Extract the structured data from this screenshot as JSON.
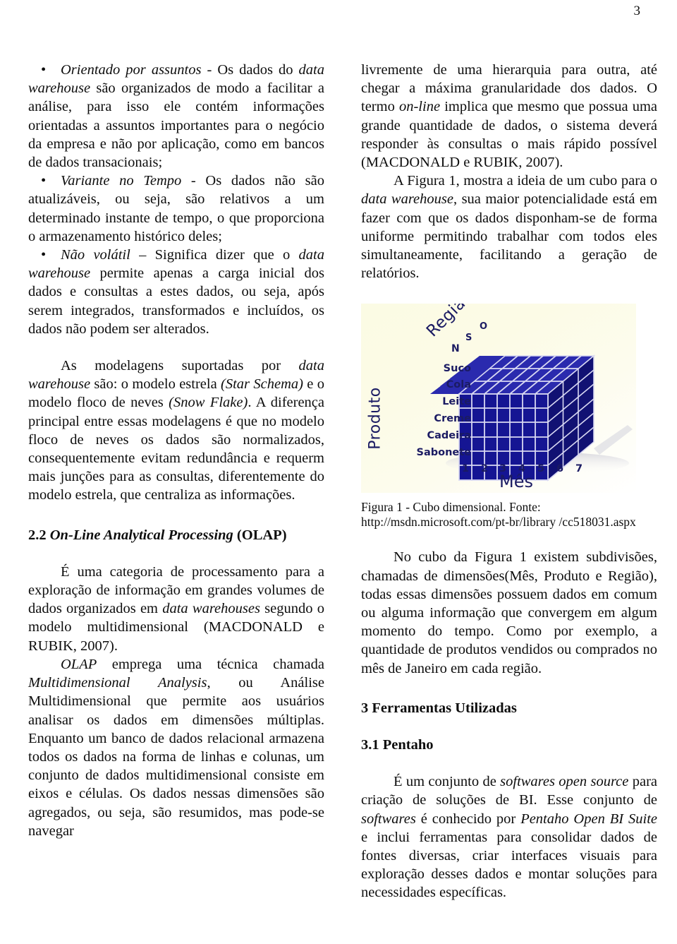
{
  "page": {
    "number": "3"
  },
  "left_column": {
    "bullet_1": {
      "term": "Orientado por assuntos",
      "text": " - Os dados do ",
      "term2": "data warehouse",
      "rest": " são organizados de modo a facilitar a análise, para isso ele contém informações orientadas a assuntos importantes para o negócio da empresa e não por aplicação, como em bancos de dados transacionais;"
    },
    "bullet_2": {
      "term": "Variante no Tempo",
      "rest": " - Os dados não são atualizáveis, ou seja, são relativos a um determinado instante de tempo, o que proporciona o armazenamento histórico deles;"
    },
    "bullet_3": {
      "term": "Não volátil",
      "mid": " – Significa dizer que o ",
      "term2": "data warehouse",
      "rest": " permite apenas a carga inicial dos dados e consultas a estes dados, ou seja, após serem integrados, transformados e incluídos, os dados não podem ser alterados."
    },
    "paragraph_modelagens": {
      "p1": "As modelagens suportadas por ",
      "i1": "data warehouse",
      "p2": " são: o modelo estrela ",
      "i2": "(Star Schema)",
      "p3": " e o modelo floco de neves ",
      "i3": "(Snow Flake)",
      "p4": ". A diferença principal entre essas modelagens é que no modelo floco de neves os dados são normalizados, consequentemente evitam redundância e requerm mais junções para as consultas, diferentemente do modelo estrela, que centraliza as informações."
    },
    "heading_olap": {
      "number": "2.2 ",
      "title_italic": "On-Line Analytical Processing",
      "title_rest": " (OLAP)"
    },
    "paragraph_olap_1": {
      "p1": "É uma categoria de processamento para a exploração de informação em grandes volumes de dados organizados em ",
      "i1": "data warehouses",
      "p2": " segundo o modelo multidimensional (MACDONALD e RUBIK, 2007)."
    },
    "paragraph_olap_2": {
      "i1": "OLAP",
      "p1": " emprega uma técnica chamada ",
      "i2": "Multidimensional Analysis",
      "p2": ", ou Análise Multidimensional que permite aos usuários analisar os dados em dimensões múltiplas. Enquanto um banco de dados relacional armazena todos os dados na forma de linhas e colunas, um conjunto de dados multidimensional consiste em eixos e células. Os dados nessas dimensões são agregados, ou seja, são resumidos, mas pode-se navegar"
    }
  },
  "right_column": {
    "paragraph_cont": {
      "p1": "livremente de uma hierarquia para outra, até chegar a máxima granularidade dos dados. O termo ",
      "i1": "on-line",
      "p2": " implica que mesmo que possua uma grande quantidade de dados, o sistema deverá responder às consultas o mais rápido possível (MACDONALD e RUBIK, 2007)."
    },
    "paragraph_figura": {
      "p1": "A Figura 1, mostra a ideia de um cubo para o ",
      "i1": "data warehouse",
      "p2": ", sua maior potencialidade está em fazer com que os dados disponham-se de forma uniforme permitindo trabalhar com todos eles simultaneamente, facilitando a geração de relatórios."
    },
    "figure": {
      "caption_line1": "Figura 1 - Cubo dimensional.  Fonte:",
      "caption_line2": "http://msdn.microsoft.com/pt-br/library /cc518031.aspx",
      "axis_product_label": "Produto",
      "axis_region_label": "Região",
      "axis_month_label": "Mês",
      "products": [
        "Suco",
        "Cola",
        "Leite",
        "Creme",
        "Cadeira",
        "Sabonete"
      ],
      "months": [
        "1",
        "2",
        "3",
        "4",
        "5",
        "6",
        "7"
      ],
      "regions": [
        "N",
        "S",
        "O"
      ],
      "colors": {
        "cube_front": "#151593",
        "cube_top": "#2b2bb0",
        "cube_side": "#0f0f66",
        "grid_line": "#ccccee",
        "label_text": "#1b1b63",
        "background": "#fbfbe4"
      }
    },
    "paragraph_cubo": "No cubo da Figura 1 existem subdivisões, chamadas de dimensões(Mês, Produto e Região), todas essas dimensões possuem dados em comum ou alguma informação que convergem em algum momento do tempo. Como por exemplo, a quantidade de produtos vendidos ou comprados no mês de Janeiro em cada região.",
    "heading_ferramentas": "3 Ferramentas Utilizadas",
    "heading_pentaho": "3.1 Pentaho",
    "paragraph_pentaho": {
      "p1": "É um conjunto de ",
      "i1": "softwares open source",
      "p2": " para criação de soluções de BI. Esse conjunto de ",
      "i2": "softwares",
      "p3": " é conhecido por ",
      "i3": "Pentaho Open BI Suite",
      "p4": " e inclui ferramentas para consolidar dados de fontes diversas, criar interfaces visuais para exploração desses dados e montar soluções para necessidades específicas."
    }
  }
}
